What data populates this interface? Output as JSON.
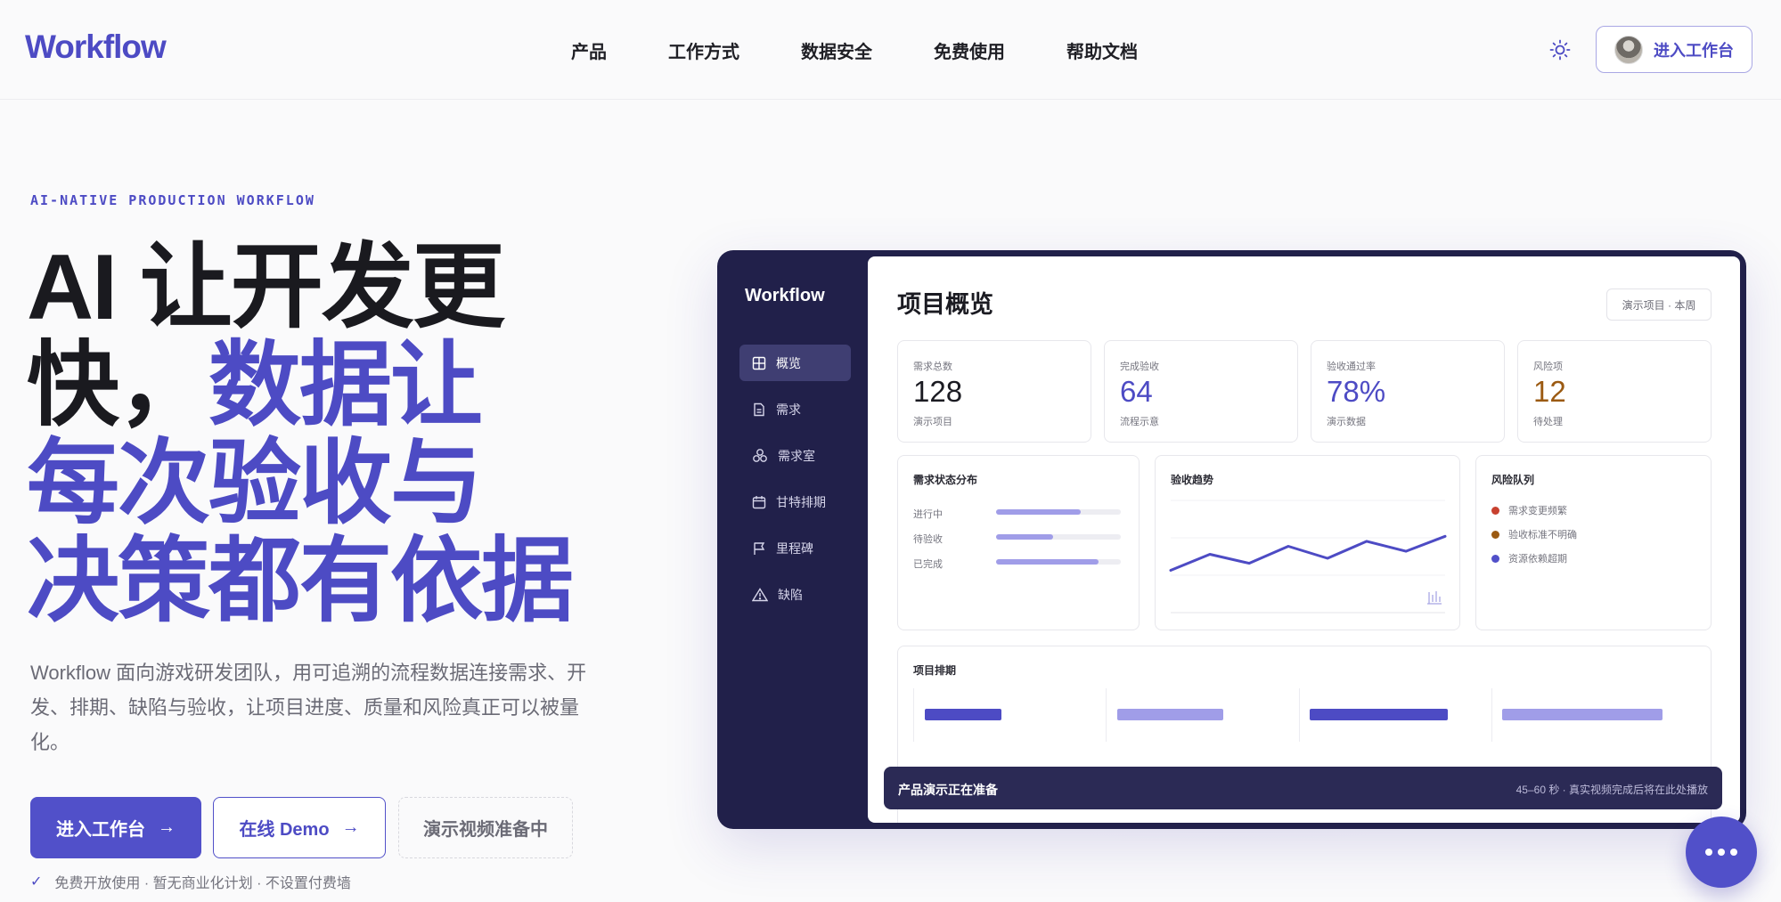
{
  "header": {
    "logo": "Workflow",
    "nav": [
      "产品",
      "工作方式",
      "数据安全",
      "免费使用",
      "帮助文档"
    ],
    "enter_button": "进入工作台",
    "theme_icon": "sun-icon"
  },
  "hero": {
    "eyebrow": "AI-NATIVE PRODUCTION WORKFLOW",
    "headline_line1": "AI 让开发更",
    "headline_line2_dark": "快，",
    "headline_line2_accent": "数据让",
    "headline_line3": "每次验收与",
    "headline_line4": "决策都有依据",
    "description": "Workflow 面向游戏研发团队，用可追溯的流程数据连接需求、开发、排期、缺陷与验收，让项目进度、质量和风险真正可以被量化。",
    "cta_primary": "进入工作台",
    "cta_demo": "在线 Demo",
    "cta_video": "演示视频准备中",
    "note": "免费开放使用 · 暂无商业化计划 · 不设置付费墙",
    "accent_color": "#4d4bc4"
  },
  "dashboard": {
    "brand": "Workflow",
    "sidebar": [
      {
        "label": "概览",
        "icon": "grid-icon",
        "active": true
      },
      {
        "label": "需求",
        "icon": "document-icon",
        "active": false
      },
      {
        "label": "需求室",
        "icon": "cluster-icon",
        "active": false
      },
      {
        "label": "甘特排期",
        "icon": "calendar-icon",
        "active": false
      },
      {
        "label": "里程碑",
        "icon": "flag-icon",
        "active": false
      },
      {
        "label": "缺陷",
        "icon": "warning-icon",
        "active": false
      }
    ],
    "title": "项目概览",
    "filter": "演示项目 · 本周",
    "kpis": [
      {
        "label": "需求总数",
        "value": "128",
        "sub": "演示项目",
        "color": "#1b1b22"
      },
      {
        "label": "完成验收",
        "value": "64",
        "sub": "流程示意",
        "color": "#4d4bc4"
      },
      {
        "label": "验收通过率",
        "value": "78%",
        "sub": "演示数据",
        "color": "#4d4bc4"
      },
      {
        "label": "风险项",
        "value": "12",
        "sub": "待处理",
        "color": "#9b5a12"
      }
    ],
    "status": {
      "title": "需求状态分布",
      "rows": [
        {
          "label": "进行中",
          "fraction": 0.68
        },
        {
          "label": "待验收",
          "fraction": 0.46
        },
        {
          "label": "已完成",
          "fraction": 0.82
        }
      ]
    },
    "trend": {
      "title": "验收趋势",
      "values": [
        28,
        44,
        35,
        52,
        40,
        57,
        47,
        62
      ]
    },
    "risk": {
      "title": "风险队列",
      "items": [
        {
          "label": "需求变更频繁",
          "color": "#c8412f"
        },
        {
          "label": "验收标准不明确",
          "color": "#9b5a12"
        },
        {
          "label": "资源依赖超期",
          "color": "#5150c9"
        }
      ]
    },
    "schedule": {
      "title": "项目排期"
    },
    "toast": {
      "title": "产品演示正在准备",
      "sub": "45–60 秒 · 真实视频完成后将在此处播放"
    }
  }
}
